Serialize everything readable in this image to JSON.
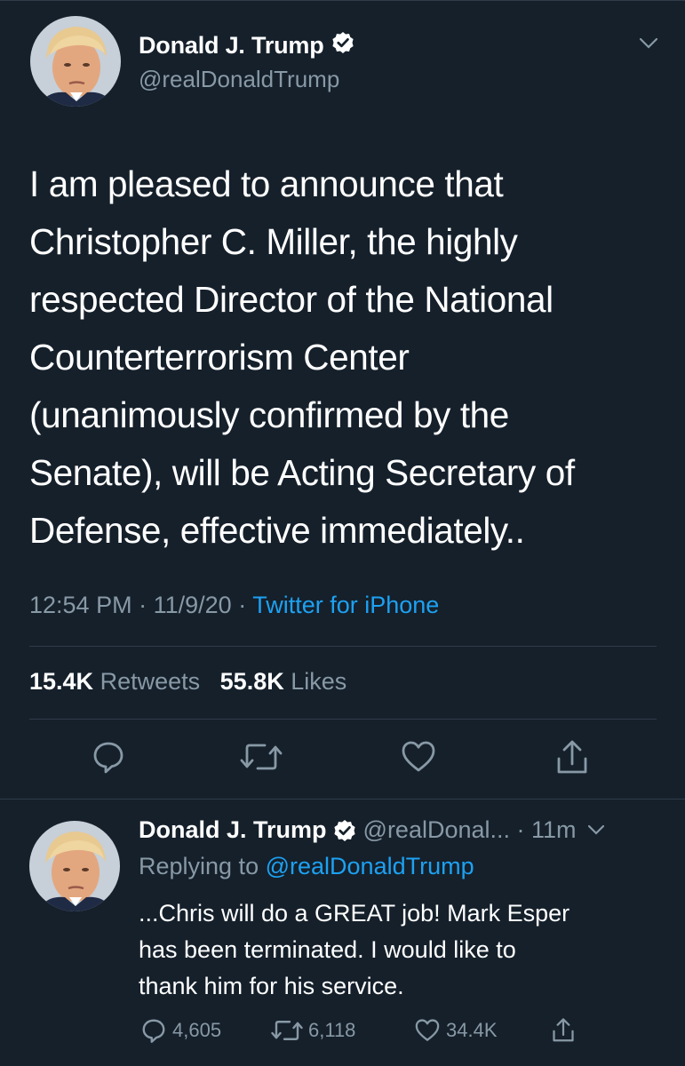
{
  "colors": {
    "background": "#15202b",
    "text": "#ffffff",
    "secondary": "#8899a6",
    "link": "#1da1f2",
    "divider": "#2f3c49"
  },
  "main_tweet": {
    "author_name": "Donald J. Trump",
    "handle": "@realDonaldTrump",
    "verified_icon": "verified-badge-icon",
    "text_lines": [
      "I am pleased to announce that",
      "Christopher C. Miller, the highly",
      "respected Director of the National",
      "Counterterrorism Center",
      "(unanimously confirmed by the",
      "Senate), will be Acting Secretary of",
      "Defense, effective immediately.."
    ],
    "time": "12:54 PM",
    "date": "11/9/20",
    "source": "Twitter for iPhone",
    "retweets": "15.4K",
    "retweets_label": "Retweets",
    "likes": "55.8K",
    "likes_label": "Likes",
    "actions": [
      "reply-icon",
      "retweet-icon",
      "like-icon",
      "share-icon"
    ]
  },
  "reply_tweet": {
    "author_name": "Donald J. Trump",
    "handle_truncated": "@realDonal...",
    "time_ago": "11m",
    "replying_label": "Replying to",
    "replying_to": "@realDonaldTrump",
    "text_lines": [
      "...Chris will do a GREAT job! Mark Esper",
      "has been terminated. I would like to",
      "thank him for his service."
    ],
    "reply_count": "4,605",
    "retweet_count": "6,118",
    "like_count": "34.4K"
  }
}
